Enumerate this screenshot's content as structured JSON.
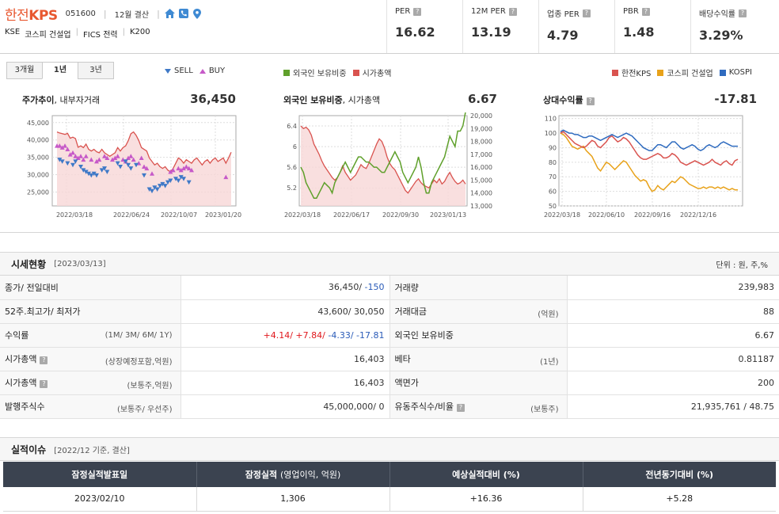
{
  "header": {
    "company_prefix": "한전",
    "company_suffix": "KPS",
    "code": "051600",
    "fiscal": "12월 결산",
    "market": "KSE",
    "sector": "코스피 건설업",
    "fics": "FICS 전력",
    "index": "K200",
    "icons": [
      "home-icon",
      "phone-icon",
      "location-pin-icon"
    ]
  },
  "metrics": [
    {
      "label": "PER",
      "value": "16.62"
    },
    {
      "label": "12M PER",
      "value": "13.19"
    },
    {
      "label": "업종 PER",
      "value": "4.79"
    },
    {
      "label": "PBR",
      "value": "1.48"
    },
    {
      "label": "배당수익률",
      "value": "3.29%"
    }
  ],
  "chart_tabs": [
    "3개월",
    "1년",
    "3년"
  ],
  "chart_legends": {
    "trades": {
      "sell": "SELL",
      "buy": "BUY"
    },
    "foreign": {
      "a": "외국인 보유비중",
      "b": "시가총액"
    },
    "relative": {
      "a": "한전KPS",
      "b": "코스피 건설업",
      "c": "KOSPI"
    }
  },
  "colors": {
    "brand": "#e8572f",
    "red": "#d9534f",
    "green": "#5fa02b",
    "orange": "#e8a21a",
    "blue": "#2f6bbf",
    "sell": "#3f79c7",
    "buy": "#c659c8"
  },
  "chart_data": [
    {
      "type": "line",
      "title_bold": "주가추이",
      "title_rest": ", 내부자거래",
      "headline": "36,450",
      "x_ticks": [
        "2022/03/18",
        "2022/06/24",
        "2022/10/07",
        "2023/01/20"
      ],
      "y_ticks": [
        "45,000",
        "40,000",
        "35,000",
        "30,000",
        "25,000"
      ],
      "ylim": [
        21000,
        47000
      ],
      "series": [
        {
          "values": [
            42300,
            42000,
            41800,
            41600,
            41900,
            40500,
            40800,
            40400,
            37900,
            38300,
            37800,
            38800,
            37300,
            36800,
            37300,
            36600,
            36300,
            37300,
            36300,
            35800,
            35300,
            35800,
            36300,
            37800,
            36800,
            37800,
            38300,
            39800,
            41800,
            42300,
            41300,
            39800,
            37800,
            37300,
            36800,
            34800,
            33800,
            32800,
            33300,
            32300,
            31800,
            32300,
            31300,
            30800,
            31800,
            33300,
            34800,
            34300,
            33300,
            34300,
            33800,
            33300,
            34300,
            34800,
            33800,
            32800,
            33800,
            34300,
            33300,
            34300,
            34800,
            33800,
            34300,
            34800,
            33300,
            34800,
            36450
          ]
        }
      ],
      "sell_marks": [
        [
          1,
          34300
        ],
        [
          2,
          33800
        ],
        [
          4,
          33300
        ],
        [
          6,
          32800
        ],
        [
          7,
          33800
        ],
        [
          9,
          32300
        ],
        [
          10,
          31300
        ],
        [
          11,
          30800
        ],
        [
          12,
          30300
        ],
        [
          13,
          29800
        ],
        [
          14,
          30300
        ],
        [
          15,
          29800
        ],
        [
          17,
          31300
        ],
        [
          18,
          31800
        ],
        [
          19,
          30800
        ],
        [
          23,
          33300
        ],
        [
          24,
          32300
        ],
        [
          26,
          33800
        ],
        [
          27,
          32800
        ],
        [
          28,
          31800
        ],
        [
          30,
          32800
        ],
        [
          33,
          29800
        ],
        [
          35,
          25800
        ],
        [
          36,
          25300
        ],
        [
          37,
          26300
        ],
        [
          38,
          25800
        ],
        [
          39,
          26800
        ],
        [
          40,
          27300
        ],
        [
          41,
          26800
        ],
        [
          42,
          27800
        ],
        [
          43,
          28300
        ],
        [
          45,
          28800
        ],
        [
          46,
          28300
        ],
        [
          47,
          29300
        ],
        [
          48,
          28800
        ],
        [
          50,
          27800
        ]
      ],
      "buy_marks": [
        [
          0,
          38300
        ],
        [
          1,
          38300
        ],
        [
          2,
          37800
        ],
        [
          3,
          38300
        ],
        [
          4,
          37300
        ],
        [
          5,
          35800
        ],
        [
          6,
          36300
        ],
        [
          7,
          35300
        ],
        [
          8,
          34800
        ],
        [
          9,
          35300
        ],
        [
          10,
          34300
        ],
        [
          11,
          35300
        ],
        [
          13,
          34300
        ],
        [
          15,
          33800
        ],
        [
          16,
          34300
        ],
        [
          18,
          35300
        ],
        [
          19,
          34800
        ],
        [
          21,
          34300
        ],
        [
          22,
          34800
        ],
        [
          23,
          35300
        ],
        [
          25,
          34300
        ],
        [
          26,
          33800
        ],
        [
          27,
          34800
        ],
        [
          28,
          35300
        ],
        [
          29,
          34300
        ],
        [
          31,
          33300
        ],
        [
          32,
          34800
        ],
        [
          33,
          32300
        ],
        [
          34,
          31800
        ],
        [
          36,
          30300
        ],
        [
          43,
          30800
        ],
        [
          44,
          31300
        ],
        [
          46,
          31800
        ],
        [
          47,
          31300
        ],
        [
          48,
          31800
        ],
        [
          49,
          32300
        ],
        [
          50,
          31800
        ],
        [
          51,
          31300
        ],
        [
          64,
          29300
        ]
      ]
    },
    {
      "type": "line",
      "title_bold": "외국인 보유비중",
      "title_rest": ", 시가총액",
      "headline": "6.67",
      "x_ticks": [
        "2022/03/18",
        "2022/06/17",
        "2022/09/30",
        "2023/01/13"
      ],
      "y_ticks_left": [
        "6.4",
        "6",
        "5.6",
        "5.2"
      ],
      "y_ticks_right": [
        "20,000",
        "19,000",
        "18,000",
        "17,000",
        "16,000",
        "15,000",
        "14,000",
        "13,000"
      ],
      "ylim_left": [
        4.85,
        6.6
      ],
      "ylim_right": [
        13000,
        20000
      ],
      "series": [
        {
          "values": [
            5.6,
            5.5,
            5.3,
            5.2,
            5.1,
            5.0,
            5.0,
            5.1,
            5.2,
            5.3,
            5.25,
            5.2,
            5.1,
            5.3,
            5.4,
            5.5,
            5.6,
            5.7,
            5.6,
            5.5,
            5.6,
            5.7,
            5.8,
            5.8,
            5.75,
            5.7,
            5.7,
            5.65,
            5.6,
            5.6,
            5.55,
            5.5,
            5.5,
            5.6,
            5.7,
            5.8,
            5.9,
            5.8,
            5.7,
            5.5,
            5.4,
            5.3,
            5.4,
            5.5,
            5.6,
            5.8,
            5.6,
            5.3,
            5.1,
            5.1,
            5.3,
            5.4,
            5.5,
            5.6,
            5.7,
            5.8,
            6.0,
            6.2,
            6.1,
            6.0,
            6.3,
            6.3,
            6.4,
            6.67
          ]
        },
        {
          "values": [
            19200,
            19000,
            19100,
            18900,
            18500,
            17800,
            17400,
            17000,
            16500,
            16100,
            15800,
            15500,
            15200,
            15000,
            15200,
            15600,
            16100,
            15600,
            15300,
            15000,
            15200,
            15400,
            15800,
            16200,
            16000,
            15900,
            16300,
            16800,
            17300,
            17800,
            18200,
            18000,
            17500,
            16800,
            16300,
            16000,
            15800,
            15400,
            15000,
            14600,
            14200,
            14000,
            14300,
            14600,
            14900,
            15100,
            14800,
            14600,
            14500,
            14400,
            14700,
            15000,
            14800,
            15100,
            14700,
            14900,
            15300,
            15600,
            15200,
            14900,
            14700,
            14800,
            15000,
            14700
          ]
        }
      ]
    },
    {
      "type": "line",
      "title_bold": "상대수익률",
      "title_rest": "",
      "headline": "-17.81",
      "x_ticks": [
        "2022/03/18",
        "2022/06/10",
        "2022/09/16",
        "2022/12/16"
      ],
      "y_ticks": [
        "110",
        "100",
        "90",
        "80",
        "70",
        "60",
        "50"
      ],
      "ylim": [
        50,
        112
      ],
      "series": [
        {
          "name": "한전KPS",
          "values": [
            100,
            101,
            99,
            97,
            95,
            93,
            92,
            91,
            90,
            91,
            93,
            95,
            94,
            91,
            90,
            92,
            94,
            97,
            98,
            96,
            94,
            95,
            97,
            96,
            94,
            91,
            88,
            85,
            83,
            82,
            82,
            83,
            84,
            85,
            86,
            85,
            83,
            83,
            84,
            86,
            85,
            83,
            80,
            79,
            78,
            79,
            80,
            81,
            80,
            79,
            78,
            79,
            80,
            82,
            80,
            79,
            78,
            80,
            81,
            79,
            78,
            81,
            82
          ]
        },
        {
          "name": "코스피 건설업",
          "values": [
            100,
            99,
            97,
            94,
            91,
            90,
            89,
            90,
            91,
            88,
            86,
            84,
            80,
            76,
            74,
            77,
            80,
            79,
            77,
            75,
            77,
            79,
            81,
            80,
            77,
            74,
            71,
            69,
            67,
            68,
            67,
            63,
            60,
            61,
            64,
            62,
            61,
            63,
            65,
            67,
            66,
            68,
            70,
            69,
            67,
            65,
            64,
            63,
            62,
            62,
            63,
            62,
            63,
            63,
            62,
            63,
            62,
            63,
            62,
            61,
            62,
            61,
            61
          ]
        },
        {
          "name": "KOSPI",
          "values": [
            101,
            102,
            101,
            100,
            100,
            99,
            99,
            98,
            97,
            97,
            98,
            98,
            97,
            96,
            95,
            96,
            97,
            98,
            99,
            98,
            97,
            98,
            99,
            100,
            99,
            98,
            96,
            94,
            92,
            90,
            89,
            88,
            88,
            90,
            92,
            92,
            91,
            90,
            92,
            94,
            94,
            92,
            90,
            89,
            90,
            91,
            92,
            91,
            89,
            88,
            89,
            91,
            92,
            91,
            90,
            91,
            93,
            94,
            93,
            92,
            91,
            91,
            91
          ]
        }
      ]
    }
  ],
  "price": {
    "title": "시세현황",
    "date": "[2023/03/13]",
    "unit": "단위 : 원, 주,%",
    "rows": [
      {
        "k1": "종가/ 전일대비",
        "s1": "",
        "close": "36,450/",
        "change": " -150",
        "k2": "거래량",
        "s2": "",
        "v2": "239,983"
      },
      {
        "k1": "52주.최고가/ 최저가",
        "s1": "",
        "v1": "43,600/ 30,050",
        "k2": "거래대금",
        "s2": "(억원)",
        "v2": "88"
      },
      {
        "k1": "수익률",
        "s1": "(1M/ 3M/ 6M/ 1Y)",
        "r1": "+4.14/",
        "r2": " +7.84/",
        "r3": " -4.33/",
        "r4": " -17.81",
        "k2": "외국인 보유비중",
        "s2": "",
        "v2": "6.67"
      },
      {
        "k1": "시가총액",
        "s1": "(상장예정포함,억원)",
        "v1": "16,403",
        "k2": "베타",
        "s2": "(1년)",
        "v2": "0.81187"
      },
      {
        "k1": "시가총액",
        "s1": "(보통주,억원)",
        "v1": "16,403",
        "k2": "액면가",
        "s2": "",
        "v2": "200"
      },
      {
        "k1": "발행주식수",
        "s1": "(보통주/ 우선주)",
        "v1": "45,000,000/ 0",
        "k2": "유동주식수/비율",
        "s2": "(보통주)",
        "v2": "21,935,761 / 48.75"
      }
    ]
  },
  "earnings": {
    "title": "실적이슈",
    "subtitle": "[2022/12 기준, 결산]",
    "headers": [
      "잠정실적발표일",
      "잠정실적",
      "(영업이익, 억원)",
      "예상실적대비 (%)",
      "전년동기대비 (%)"
    ],
    "row": [
      "2023/02/10",
      "1,306",
      "+16.36",
      "+5.28"
    ]
  }
}
